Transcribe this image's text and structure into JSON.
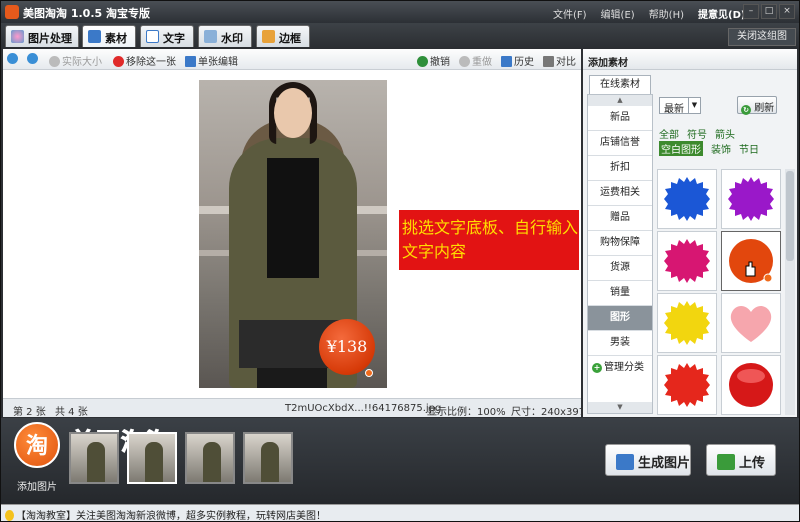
{
  "app": {
    "title": "美图淘淘 1.0.5 淘宝专版"
  },
  "menu": [
    "文件(F)",
    "编辑(E)",
    "帮助(H)",
    "提意见(D)"
  ],
  "window_buttons": [
    "–",
    "□",
    "×"
  ],
  "tabs": [
    {
      "label": "图片处理",
      "icon": "photo-icon"
    },
    {
      "label": "素材",
      "icon": "material-icon"
    },
    {
      "label": "文字",
      "icon": "text-icon"
    },
    {
      "label": "水印",
      "icon": "watermark-icon"
    },
    {
      "label": "边框",
      "icon": "frame-icon"
    }
  ],
  "active_tab": "素材",
  "close_map": "关闭这组图",
  "toolbar": {
    "actual_size": "实际大小",
    "remove": "移除这一张",
    "edit_single": "单张编辑",
    "undo": "撤销",
    "redo": "重做",
    "history": "历史",
    "compare": "对比"
  },
  "canvas": {
    "price_label": "¥138",
    "tip_text": "挑选文字底板、自行输入文字内容"
  },
  "status": {
    "page": "第 2 张",
    "total": "共 4 张",
    "filename": "T2mUOcXbdX...!!64176875.jpg",
    "zoom": "显示比例：100%",
    "size": "尺寸：240x397"
  },
  "right_panel": {
    "header": "添加素材",
    "tab": "在线素材",
    "sort": "最新",
    "refresh": "刷新",
    "categories": [
      "新品",
      "店铺信誉",
      "折扣",
      "运费相关",
      "赠品",
      "购物保障",
      "货源",
      "销量",
      "图形",
      "男装"
    ],
    "selected_category": "图形",
    "manage": "管理分类",
    "filters_row1": [
      "全部",
      "符号",
      "箭头"
    ],
    "filters_row2": [
      "空白图形",
      "装饰",
      "节日"
    ],
    "active_filter": "空白图形",
    "shapes": [
      {
        "name": "blue-burst-shape",
        "color": "#1b57d6"
      },
      {
        "name": "purple-burst-shape",
        "color": "#9a18c9"
      },
      {
        "name": "magenta-burst-shape",
        "color": "#d71672"
      },
      {
        "name": "orange-circle-shape",
        "color": "#e2470d"
      },
      {
        "name": "yellow-burst-shape",
        "color": "#f2d60f"
      },
      {
        "name": "pink-heart-shape",
        "color": "#f6a6ad"
      },
      {
        "name": "red-burst-shape",
        "color": "#e5271c"
      },
      {
        "name": "red-circle-shape",
        "color": "#d61818"
      }
    ]
  },
  "bottom": {
    "add_picture": "添加图片",
    "add_logo": "淘",
    "brand": "美图淘淘",
    "generate": "生成图片",
    "upload": "上传"
  },
  "notice": "【淘淘教室】关注美图淘淘新浪微博，超多实例教程，玩转网店美图！",
  "colors": {
    "accent": "#e65a1c",
    "tip_bg": "#e21313",
    "tip_text": "#ffde00",
    "filter_active": "#3d8a2e"
  }
}
